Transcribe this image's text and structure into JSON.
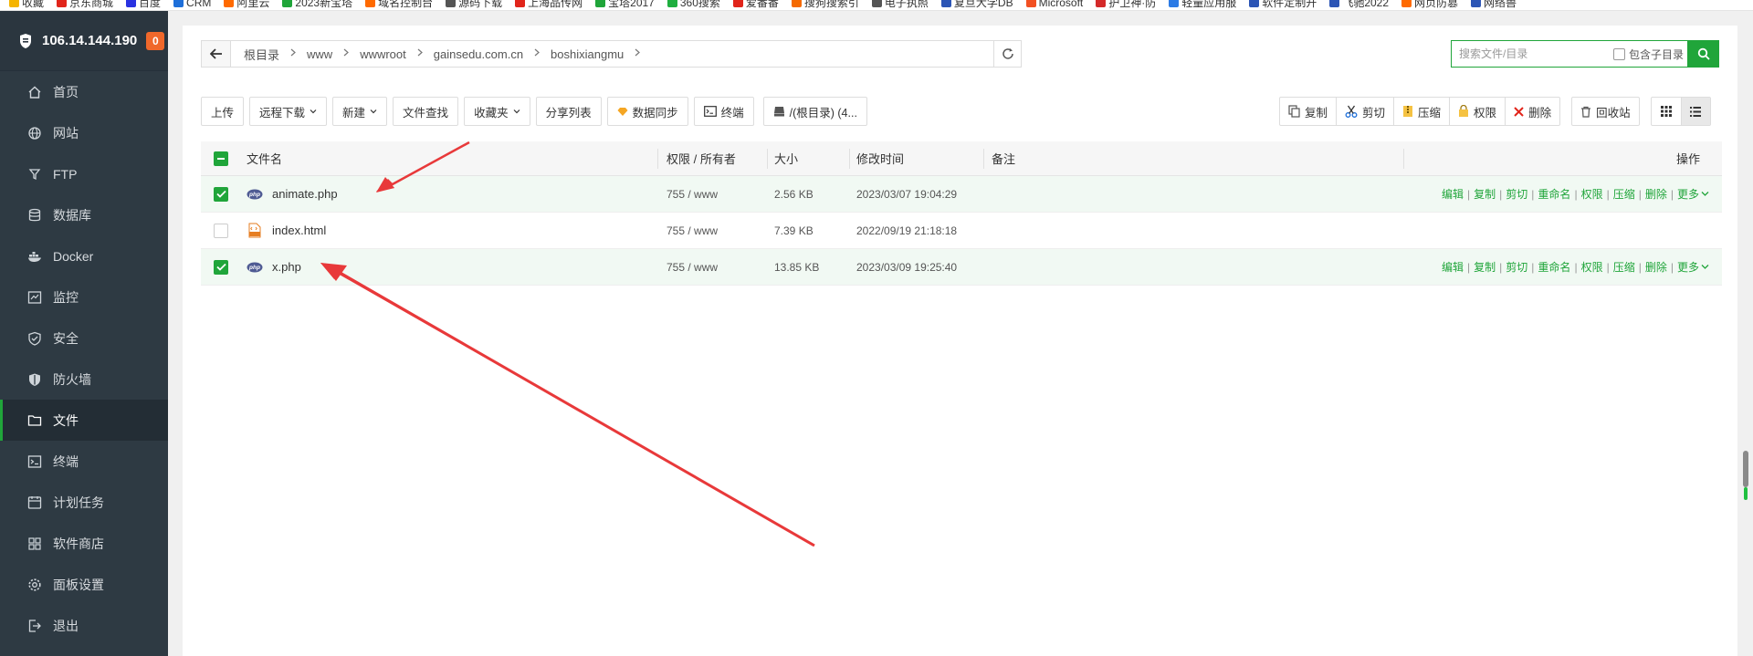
{
  "bookmarks": [
    {
      "label": "收藏",
      "color": "#f5b400"
    },
    {
      "label": "京东商城",
      "color": "#e1251b"
    },
    {
      "label": "百度",
      "color": "#2932e1"
    },
    {
      "label": "CRM",
      "color": "#1e6fd9"
    },
    {
      "label": "阿里云",
      "color": "#ff6a00"
    },
    {
      "label": "2023新宝塔",
      "color": "#20a53a"
    },
    {
      "label": "域名控制台",
      "color": "#ff6a00"
    },
    {
      "label": "源码下载",
      "color": "#555555"
    },
    {
      "label": "上海品传网",
      "color": "#e1251b"
    },
    {
      "label": "宝塔2017",
      "color": "#20a53a"
    },
    {
      "label": "360搜索",
      "color": "#1fae3f"
    },
    {
      "label": "爱番番",
      "color": "#e1251b"
    },
    {
      "label": "搜狗搜索引",
      "color": "#f56a00"
    },
    {
      "label": "电子执照",
      "color": "#555555"
    },
    {
      "label": "复旦大学DB",
      "color": "#2c55b5"
    },
    {
      "label": "Microsoft",
      "color": "#f25022"
    },
    {
      "label": "护卫神·防",
      "color": "#d42a2a"
    },
    {
      "label": "轻量应用服",
      "color": "#2c7be5"
    },
    {
      "label": "软件定制开",
      "color": "#2c55b5"
    },
    {
      "label": "飞驰2022",
      "color": "#2c55b5"
    },
    {
      "label": "网页防篡",
      "color": "#ff6a00"
    },
    {
      "label": "网络兽",
      "color": "#2c55b5"
    }
  ],
  "sidebar": {
    "ip": "106.14.144.190",
    "badge": "0",
    "items": [
      {
        "label": "首页",
        "icon": "home-icon"
      },
      {
        "label": "网站",
        "icon": "globe-icon"
      },
      {
        "label": "FTP",
        "icon": "ftp-icon"
      },
      {
        "label": "数据库",
        "icon": "database-icon"
      },
      {
        "label": "Docker",
        "icon": "docker-icon"
      },
      {
        "label": "监控",
        "icon": "monitor-icon"
      },
      {
        "label": "安全",
        "icon": "shield-icon"
      },
      {
        "label": "防火墙",
        "icon": "firewall-icon"
      },
      {
        "label": "文件",
        "icon": "folder-icon",
        "active": true
      },
      {
        "label": "终端",
        "icon": "terminal-icon"
      },
      {
        "label": "计划任务",
        "icon": "clock-icon"
      },
      {
        "label": "软件商店",
        "icon": "apps-icon"
      },
      {
        "label": "面板设置",
        "icon": "gear-icon"
      },
      {
        "label": "退出",
        "icon": "logout-icon"
      }
    ]
  },
  "path": {
    "crumbs": [
      "根目录",
      "www",
      "wwwroot",
      "gainsedu.com.cn",
      "boshixiangmu"
    ]
  },
  "search": {
    "placeholder": "搜索文件/目录",
    "subdir_label": "包含子目录"
  },
  "toolbar": {
    "upload": "上传",
    "remote_download": "远程下载",
    "new": "新建",
    "find": "文件查找",
    "favorites": "收藏夹",
    "share_list": "分享列表",
    "sync": "数据同步",
    "terminal": "终端",
    "disk": "/(根目录) (4..."
  },
  "toolbar_right": {
    "copy": "复制",
    "cut": "剪切",
    "compress": "压缩",
    "perm": "权限",
    "delete": "删除",
    "recycle": "回收站"
  },
  "table": {
    "headers": {
      "name": "文件名",
      "perm": "权限 / 所有者",
      "size": "大小",
      "time": "修改时间",
      "note": "备注",
      "ops": "操作"
    },
    "rows": [
      {
        "name": "animate.php",
        "type": "php",
        "perm": "755 / www",
        "size": "2.56 KB",
        "time": "2023/03/07 19:04:29",
        "checked": true
      },
      {
        "name": "index.html",
        "type": "html",
        "perm": "755 / www",
        "size": "7.39 KB",
        "time": "2022/09/19 21:18:18",
        "checked": false
      },
      {
        "name": "x.php",
        "type": "php",
        "perm": "755 / www",
        "size": "13.85 KB",
        "time": "2023/03/09 19:25:40",
        "checked": true
      }
    ],
    "row_ops": [
      "编辑",
      "复制",
      "剪切",
      "重命名",
      "权限",
      "压缩",
      "删除",
      "更多"
    ]
  },
  "colors": {
    "accent": "#20a53a",
    "sidebar_bg": "#2e3a43",
    "badge": "#f0682b",
    "arrow": "#e8393a"
  }
}
